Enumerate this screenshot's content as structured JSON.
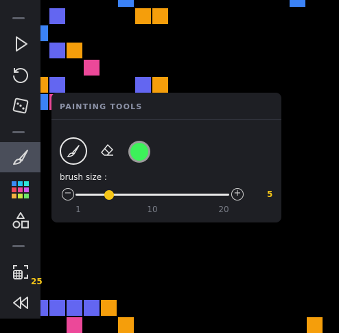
{
  "colors": {
    "blue": "#3b82f6",
    "purple": "#6366f1",
    "orange": "#f59e0b",
    "pink": "#ec4899",
    "accent": "#f5c518",
    "selected_color": "#3df15a"
  },
  "canvas": {
    "cells": [
      [
        5,
        0,
        "blue"
      ],
      [
        15,
        0,
        "blue"
      ],
      [
        1,
        1,
        "purple"
      ],
      [
        6,
        1,
        "orange"
      ],
      [
        7,
        1,
        "orange"
      ],
      [
        0,
        2,
        "blue"
      ],
      [
        1,
        3,
        "purple"
      ],
      [
        2,
        3,
        "orange"
      ],
      [
        3,
        4,
        "pink"
      ],
      [
        0,
        5,
        "orange"
      ],
      [
        1,
        5,
        "purple"
      ],
      [
        6,
        5,
        "purple"
      ],
      [
        7,
        5,
        "orange"
      ],
      [
        0,
        6,
        "blue"
      ],
      [
        1,
        6,
        "pink"
      ],
      [
        0,
        18,
        "purple"
      ],
      [
        1,
        18,
        "purple"
      ],
      [
        2,
        18,
        "purple"
      ],
      [
        3,
        18,
        "purple"
      ],
      [
        4,
        18,
        "orange"
      ],
      [
        2,
        19,
        "pink"
      ],
      [
        5,
        19,
        "orange"
      ],
      [
        16,
        19,
        "orange"
      ]
    ]
  },
  "sidebar": {
    "items": [
      {
        "icon": "play-icon"
      },
      {
        "icon": "reset-icon"
      },
      {
        "icon": "dice-icon"
      },
      {
        "icon": "paintbrush-icon",
        "active": true
      },
      {
        "icon": "palette-grid-icon"
      },
      {
        "icon": "shapes-icon"
      },
      {
        "icon": "grid-size-icon"
      },
      {
        "icon": "rewind-icon"
      }
    ],
    "grid_size": "25"
  },
  "painting_tools": {
    "title": "PAINTING TOOLS",
    "brush_size_label": "brush size :",
    "brush_size": {
      "value": "5",
      "min": 1,
      "max": 20,
      "ticks": [
        "1",
        "10",
        "20"
      ]
    },
    "minus": "−",
    "plus": "+"
  }
}
